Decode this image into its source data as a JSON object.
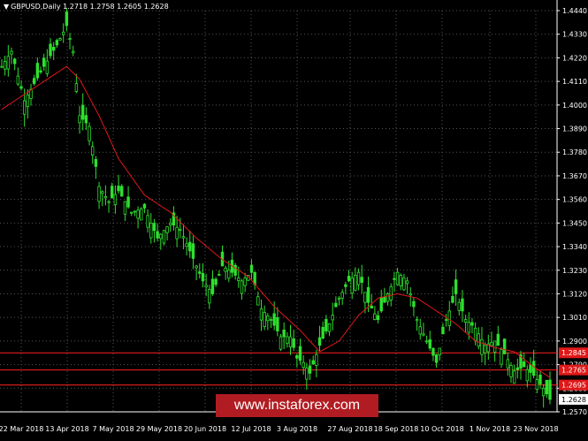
{
  "header": {
    "symbol_line": "GBPUSD,Daily  1.2718 1.2758 1.2605 1.2628",
    "collapse_icon": "triangle-down-icon"
  },
  "watermark": {
    "text": "www.instaforex.com"
  },
  "colors": {
    "background": "#000000",
    "grid": "#555555",
    "bull": "#2ee02e",
    "bear": "#2ee02e",
    "ma": "#e01818",
    "level_line": "#ff2020",
    "label_red": "#e01818",
    "label_white": "#ffffff"
  },
  "chart_data": {
    "type": "candlestick",
    "symbol": "GBPUSD",
    "timeframe": "Daily",
    "ohlc_last": {
      "open": 1.2718,
      "high": 1.2758,
      "low": 1.2605,
      "close": 1.2628
    },
    "ylim": [
      1.257,
      1.444
    ],
    "y_ticks": [
      "1.4440",
      "1.4330",
      "1.4220",
      "1.4110",
      "1.4000",
      "1.3890",
      "1.3780",
      "1.3670",
      "1.3560",
      "1.3450",
      "1.3340",
      "1.3230",
      "1.3120",
      "1.3010",
      "1.2900",
      "1.2790",
      "1.2680",
      "1.2570"
    ],
    "x_ticks": [
      "22 Mar 2018",
      "13 Apr 2018",
      "7 May 2018",
      "29 May 2018",
      "20 Jun 2018",
      "12 Jul 2018",
      "3 Aug 2018",
      "27 Aug 2018",
      "18 Sep 2018",
      "10 Oct 2018",
      "1 Nov 2018",
      "23 Nov 2018"
    ],
    "horizontal_levels": [
      {
        "price": 1.2845,
        "label": "1.2845",
        "label_style": "red"
      },
      {
        "price": 1.2765,
        "label": "1.2765",
        "label_style": "red"
      },
      {
        "price": 1.2695,
        "label": "1.2695",
        "label_style": "red"
      }
    ],
    "current_price_label": "1.2628",
    "close_path": [
      [
        0,
        1.418
      ],
      [
        3,
        1.425
      ],
      [
        7,
        1.402
      ],
      [
        10,
        1.41
      ],
      [
        13,
        1.418
      ],
      [
        17,
        1.428
      ],
      [
        20,
        1.437
      ],
      [
        22,
        1.425
      ],
      [
        24,
        1.395
      ],
      [
        27,
        1.39
      ],
      [
        30,
        1.362
      ],
      [
        33,
        1.355
      ],
      [
        36,
        1.36
      ],
      [
        40,
        1.35
      ],
      [
        44,
        1.352
      ],
      [
        48,
        1.338
      ],
      [
        52,
        1.345
      ],
      [
        55,
        1.342
      ],
      [
        58,
        1.332
      ],
      [
        62,
        1.318
      ],
      [
        65,
        1.312
      ],
      [
        68,
        1.325
      ],
      [
        71,
        1.322
      ],
      [
        74,
        1.318
      ],
      [
        77,
        1.322
      ],
      [
        80,
        1.305
      ],
      [
        83,
        1.3
      ],
      [
        86,
        1.292
      ],
      [
        89,
        1.292
      ],
      [
        91,
        1.282
      ],
      [
        93,
        1.28
      ],
      [
        95,
        1.275
      ],
      [
        98,
        1.288
      ],
      [
        101,
        1.298
      ],
      [
        104,
        1.31
      ],
      [
        107,
        1.318
      ],
      [
        110,
        1.322
      ],
      [
        113,
        1.308
      ],
      [
        116,
        1.3
      ],
      [
        119,
        1.312
      ],
      [
        122,
        1.322
      ],
      [
        125,
        1.318
      ],
      [
        128,
        1.3
      ],
      [
        131,
        1.29
      ],
      [
        134,
        1.28
      ],
      [
        137,
        1.3
      ],
      [
        140,
        1.312
      ],
      [
        143,
        1.3
      ],
      [
        146,
        1.296
      ],
      [
        149,
        1.288
      ],
      [
        152,
        1.29
      ],
      [
        155,
        1.284
      ],
      [
        158,
        1.276
      ],
      [
        161,
        1.278
      ],
      [
        164,
        1.274
      ],
      [
        167,
        1.268
      ],
      [
        169,
        1.2628
      ]
    ],
    "ma_path": [
      [
        0,
        1.398
      ],
      [
        10,
        1.408
      ],
      [
        20,
        1.418
      ],
      [
        24,
        1.412
      ],
      [
        30,
        1.395
      ],
      [
        36,
        1.375
      ],
      [
        44,
        1.358
      ],
      [
        52,
        1.35
      ],
      [
        60,
        1.338
      ],
      [
        68,
        1.328
      ],
      [
        76,
        1.32
      ],
      [
        84,
        1.306
      ],
      [
        92,
        1.295
      ],
      [
        98,
        1.285
      ],
      [
        104,
        1.29
      ],
      [
        110,
        1.302
      ],
      [
        116,
        1.31
      ],
      [
        122,
        1.312
      ],
      [
        128,
        1.31
      ],
      [
        134,
        1.304
      ],
      [
        140,
        1.298
      ],
      [
        146,
        1.29
      ],
      [
        152,
        1.287
      ],
      [
        158,
        1.285
      ],
      [
        164,
        1.278
      ],
      [
        169,
        1.273
      ]
    ],
    "bars_count": 170
  }
}
